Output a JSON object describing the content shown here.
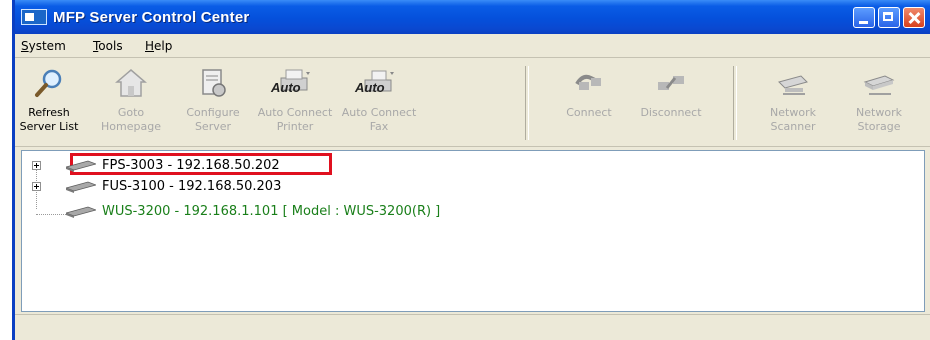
{
  "window": {
    "title": "MFP Server Control Center"
  },
  "menu": {
    "items": [
      "System",
      "Tools",
      "Help"
    ]
  },
  "toolbar": {
    "buttons": [
      {
        "line1": "Refresh",
        "line2": "Server List",
        "enabled": true,
        "icon": "magnifier-icon"
      },
      {
        "line1": "Goto",
        "line2": "Homepage",
        "enabled": false,
        "icon": "home-icon"
      },
      {
        "line1": "Configure",
        "line2": "Server",
        "enabled": false,
        "icon": "configure-icon"
      },
      {
        "line1": "Auto Connect",
        "line2": "Printer",
        "enabled": false,
        "icon": "printer-auto-icon",
        "overlay": "Auto"
      },
      {
        "line1": "Auto Connect",
        "line2": "Fax",
        "enabled": false,
        "icon": "fax-auto-icon",
        "overlay": "Auto"
      },
      {
        "line1": "Connect",
        "line2": "",
        "enabled": false,
        "icon": "connect-icon"
      },
      {
        "line1": "Disconnect",
        "line2": "",
        "enabled": false,
        "icon": "disconnect-icon"
      },
      {
        "line1": "Network",
        "line2": "Scanner",
        "enabled": false,
        "icon": "scanner-icon"
      },
      {
        "line1": "Network",
        "line2": "Storage",
        "enabled": false,
        "icon": "storage-icon"
      }
    ]
  },
  "tree": {
    "nodes": [
      {
        "label": "FPS-3003 - 192.168.50.202",
        "color": "#000000",
        "selected": true,
        "expandable": true
      },
      {
        "label": "FUS-3100 - 192.168.50.203",
        "color": "#000000",
        "selected": false,
        "expandable": true
      },
      {
        "label": "WUS-3200 - 192.168.1.101 [ Model : WUS-3200(R) ]",
        "color": "#1a7f1a",
        "selected": false,
        "expandable": false
      }
    ]
  },
  "colors": {
    "highlight": "#e0101f",
    "titlebar": "#0550db"
  }
}
